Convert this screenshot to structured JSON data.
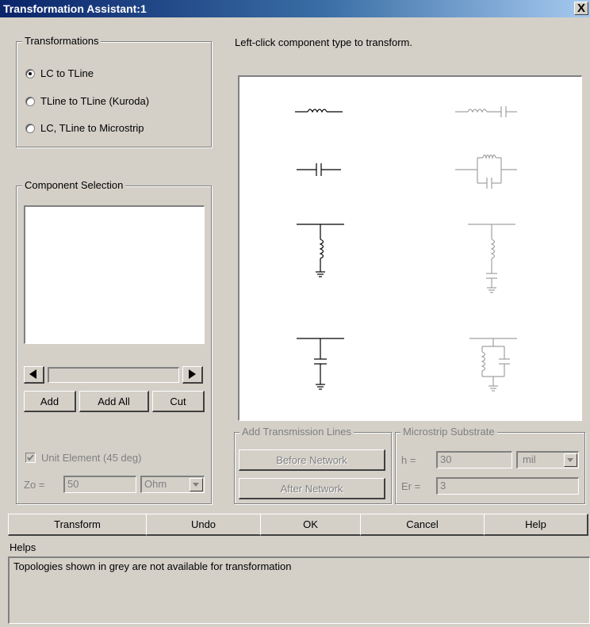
{
  "window": {
    "title": "Transformation Assistant:1",
    "close_label": "X"
  },
  "transformations": {
    "legend": "Transformations",
    "options": [
      {
        "label": "LC to TLine",
        "selected": true
      },
      {
        "label": "TLine to TLine (Kuroda)",
        "selected": false
      },
      {
        "label": "LC, TLine to Microstrip",
        "selected": false
      }
    ]
  },
  "instruction": "Left-click component type to transform.",
  "component_selection": {
    "legend": "Component Selection",
    "add_label": "Add",
    "add_all_label": "Add All",
    "cut_label": "Cut"
  },
  "unit_element": {
    "label": "Unit Element (45 deg)",
    "checked": true,
    "zo_label": "Zo =",
    "zo_value": "50",
    "unit": "Ohm"
  },
  "add_tlines": {
    "legend": "Add Transmission Lines",
    "before_label": "Before Network",
    "after_label": "After Network"
  },
  "microstrip": {
    "legend": "Microstrip Substrate",
    "h_label": "h =",
    "h_value": "30",
    "h_unit": "mil",
    "er_label": "Er =",
    "er_value": "3"
  },
  "bottom_buttons": {
    "transform": "Transform",
    "undo": "Undo",
    "ok": "OK",
    "cancel": "Cancel",
    "help": "Help"
  },
  "helps": {
    "label": "Helps",
    "text": "Topologies shown in grey are not available for transformation"
  },
  "colors": {
    "available": "#000000",
    "unavailable": "#a0a0a0"
  },
  "topologies": [
    {
      "name": "series-inductor",
      "available": true
    },
    {
      "name": "series-lc",
      "available": false
    },
    {
      "name": "series-capacitor",
      "available": true
    },
    {
      "name": "parallel-lc-series",
      "available": false
    },
    {
      "name": "shunt-inductor",
      "available": true
    },
    {
      "name": "shunt-series-lc",
      "available": false
    },
    {
      "name": "shunt-capacitor",
      "available": true
    },
    {
      "name": "shunt-parallel-lc",
      "available": false
    }
  ]
}
